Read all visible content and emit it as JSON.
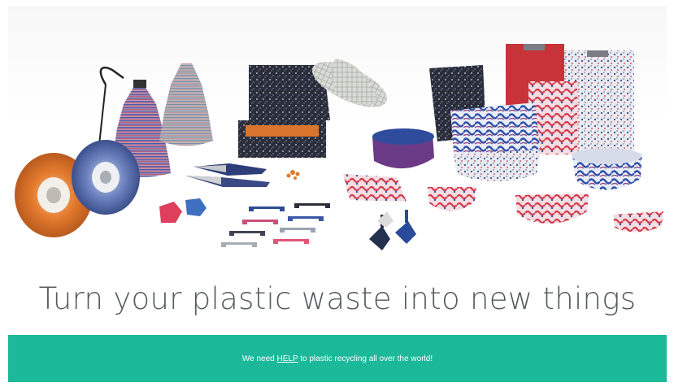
{
  "hero": {
    "image_alt": "Products made from recycled plastic: filament spools, lamp shades, boxes, hat, bowls, clipboards, handles and spinning tops",
    "headline": "Turn your plastic waste into new things"
  },
  "banner": {
    "text_before": "We need ",
    "link_label": "HELP",
    "text_after": " to plastic recycling all over the world!",
    "color": "#1bb89a"
  }
}
